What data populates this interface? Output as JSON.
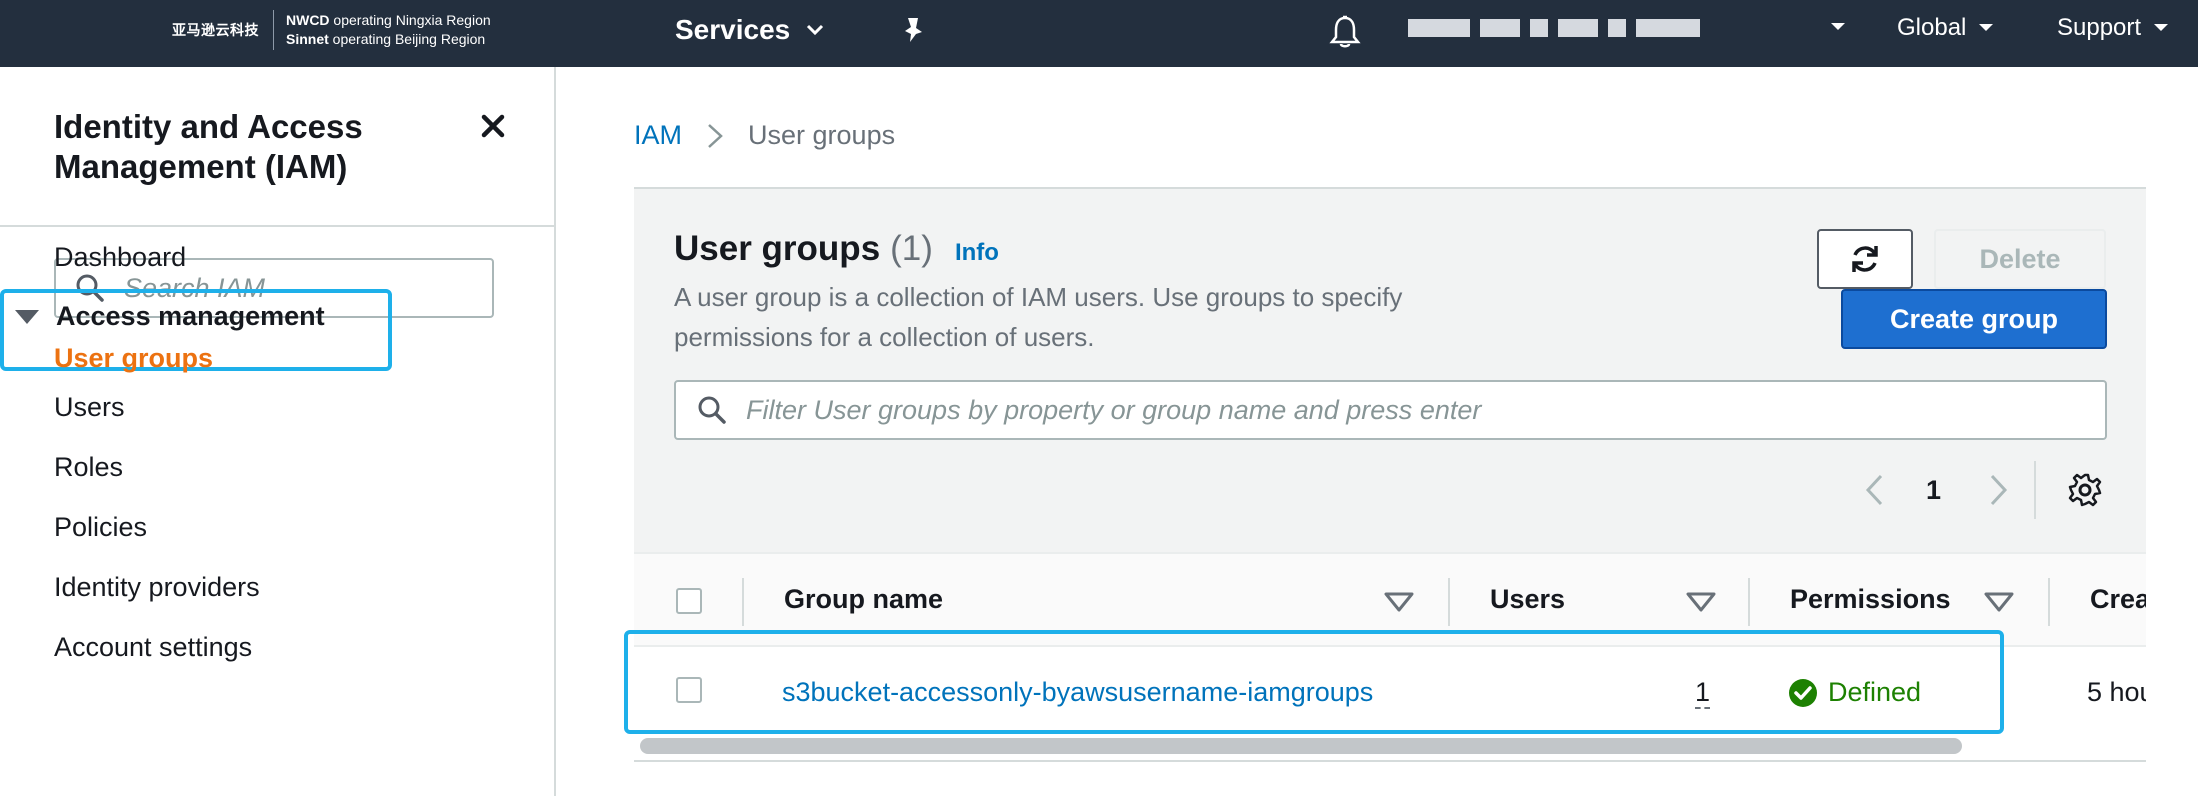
{
  "topnav": {
    "brand_cn": "亚马逊云科技",
    "region_line1_bold": "NWCD",
    "region_line1_rest": " operating Ningxia Region",
    "region_line2_bold": "Sinnet",
    "region_line2_rest": " operating Beijing Region",
    "services_label": "Services",
    "global_label": "Global",
    "support_label": "Support"
  },
  "sidebar": {
    "title": "Identity and Access Management (IAM)",
    "search_placeholder": "Search IAM",
    "dashboard_label": "Dashboard",
    "section_label": "Access management",
    "active_item": "User groups",
    "items": [
      {
        "label": "Users"
      },
      {
        "label": "Roles"
      },
      {
        "label": "Policies"
      },
      {
        "label": "Identity providers"
      },
      {
        "label": "Account settings"
      }
    ]
  },
  "breadcrumb": {
    "root": "IAM",
    "current": "User groups"
  },
  "panel": {
    "title": "User groups",
    "count": "(1)",
    "info": "Info",
    "description": "A user group is a collection of IAM users. Use groups to specify permissions for a collection of users.",
    "delete_label": "Delete",
    "create_label": "Create group",
    "filter_placeholder": "Filter User groups by property or group name and press enter",
    "page": "1"
  },
  "table": {
    "columns": [
      {
        "label": "Group name"
      },
      {
        "label": "Users"
      },
      {
        "label": "Permissions"
      },
      {
        "label": "Crea"
      }
    ],
    "rows": [
      {
        "group_name": "s3bucket-accessonly-byawsusername-iamgroups",
        "users": "1",
        "permissions": "Defined",
        "created": "5 hou"
      }
    ]
  },
  "colors": {
    "nav_bg": "#232f3e",
    "link": "#0073bb",
    "active": "#ec7211",
    "primary_button": "#1e6fd0",
    "success": "#1d8102",
    "highlight": "#1eb0ea"
  }
}
